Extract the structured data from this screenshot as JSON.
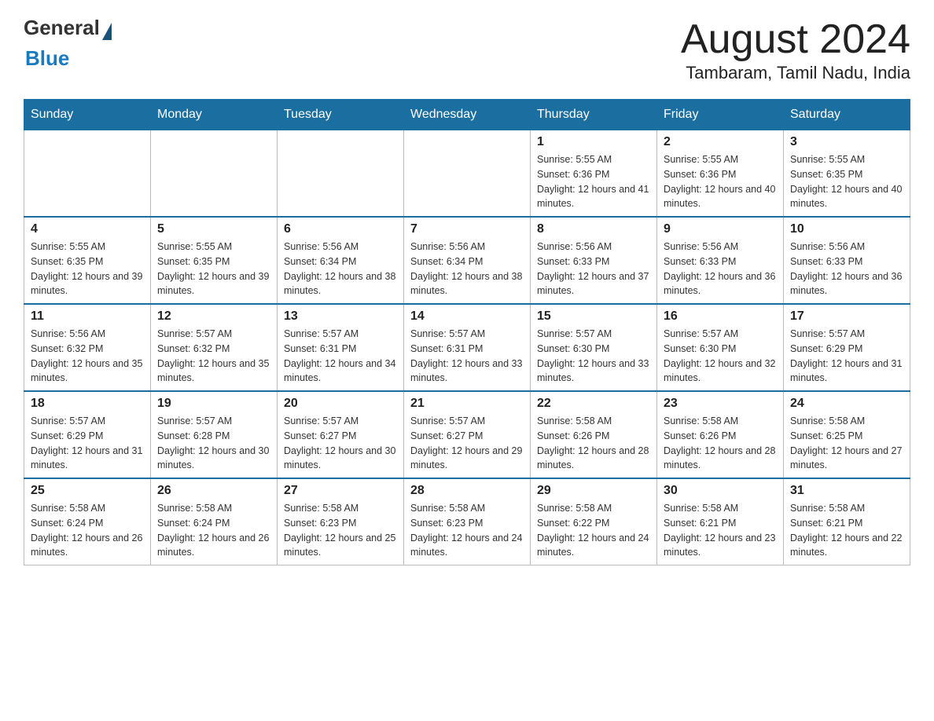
{
  "header": {
    "logo_general": "General",
    "logo_blue": "Blue",
    "month_title": "August 2024",
    "location": "Tambaram, Tamil Nadu, India"
  },
  "weekdays": [
    "Sunday",
    "Monday",
    "Tuesday",
    "Wednesday",
    "Thursday",
    "Friday",
    "Saturday"
  ],
  "weeks": [
    [
      {
        "day": "",
        "sunrise": "",
        "sunset": "",
        "daylight": ""
      },
      {
        "day": "",
        "sunrise": "",
        "sunset": "",
        "daylight": ""
      },
      {
        "day": "",
        "sunrise": "",
        "sunset": "",
        "daylight": ""
      },
      {
        "day": "",
        "sunrise": "",
        "sunset": "",
        "daylight": ""
      },
      {
        "day": "1",
        "sunrise": "Sunrise: 5:55 AM",
        "sunset": "Sunset: 6:36 PM",
        "daylight": "Daylight: 12 hours and 41 minutes."
      },
      {
        "day": "2",
        "sunrise": "Sunrise: 5:55 AM",
        "sunset": "Sunset: 6:36 PM",
        "daylight": "Daylight: 12 hours and 40 minutes."
      },
      {
        "day": "3",
        "sunrise": "Sunrise: 5:55 AM",
        "sunset": "Sunset: 6:35 PM",
        "daylight": "Daylight: 12 hours and 40 minutes."
      }
    ],
    [
      {
        "day": "4",
        "sunrise": "Sunrise: 5:55 AM",
        "sunset": "Sunset: 6:35 PM",
        "daylight": "Daylight: 12 hours and 39 minutes."
      },
      {
        "day": "5",
        "sunrise": "Sunrise: 5:55 AM",
        "sunset": "Sunset: 6:35 PM",
        "daylight": "Daylight: 12 hours and 39 minutes."
      },
      {
        "day": "6",
        "sunrise": "Sunrise: 5:56 AM",
        "sunset": "Sunset: 6:34 PM",
        "daylight": "Daylight: 12 hours and 38 minutes."
      },
      {
        "day": "7",
        "sunrise": "Sunrise: 5:56 AM",
        "sunset": "Sunset: 6:34 PM",
        "daylight": "Daylight: 12 hours and 38 minutes."
      },
      {
        "day": "8",
        "sunrise": "Sunrise: 5:56 AM",
        "sunset": "Sunset: 6:33 PM",
        "daylight": "Daylight: 12 hours and 37 minutes."
      },
      {
        "day": "9",
        "sunrise": "Sunrise: 5:56 AM",
        "sunset": "Sunset: 6:33 PM",
        "daylight": "Daylight: 12 hours and 36 minutes."
      },
      {
        "day": "10",
        "sunrise": "Sunrise: 5:56 AM",
        "sunset": "Sunset: 6:33 PM",
        "daylight": "Daylight: 12 hours and 36 minutes."
      }
    ],
    [
      {
        "day": "11",
        "sunrise": "Sunrise: 5:56 AM",
        "sunset": "Sunset: 6:32 PM",
        "daylight": "Daylight: 12 hours and 35 minutes."
      },
      {
        "day": "12",
        "sunrise": "Sunrise: 5:57 AM",
        "sunset": "Sunset: 6:32 PM",
        "daylight": "Daylight: 12 hours and 35 minutes."
      },
      {
        "day": "13",
        "sunrise": "Sunrise: 5:57 AM",
        "sunset": "Sunset: 6:31 PM",
        "daylight": "Daylight: 12 hours and 34 minutes."
      },
      {
        "day": "14",
        "sunrise": "Sunrise: 5:57 AM",
        "sunset": "Sunset: 6:31 PM",
        "daylight": "Daylight: 12 hours and 33 minutes."
      },
      {
        "day": "15",
        "sunrise": "Sunrise: 5:57 AM",
        "sunset": "Sunset: 6:30 PM",
        "daylight": "Daylight: 12 hours and 33 minutes."
      },
      {
        "day": "16",
        "sunrise": "Sunrise: 5:57 AM",
        "sunset": "Sunset: 6:30 PM",
        "daylight": "Daylight: 12 hours and 32 minutes."
      },
      {
        "day": "17",
        "sunrise": "Sunrise: 5:57 AM",
        "sunset": "Sunset: 6:29 PM",
        "daylight": "Daylight: 12 hours and 31 minutes."
      }
    ],
    [
      {
        "day": "18",
        "sunrise": "Sunrise: 5:57 AM",
        "sunset": "Sunset: 6:29 PM",
        "daylight": "Daylight: 12 hours and 31 minutes."
      },
      {
        "day": "19",
        "sunrise": "Sunrise: 5:57 AM",
        "sunset": "Sunset: 6:28 PM",
        "daylight": "Daylight: 12 hours and 30 minutes."
      },
      {
        "day": "20",
        "sunrise": "Sunrise: 5:57 AM",
        "sunset": "Sunset: 6:27 PM",
        "daylight": "Daylight: 12 hours and 30 minutes."
      },
      {
        "day": "21",
        "sunrise": "Sunrise: 5:57 AM",
        "sunset": "Sunset: 6:27 PM",
        "daylight": "Daylight: 12 hours and 29 minutes."
      },
      {
        "day": "22",
        "sunrise": "Sunrise: 5:58 AM",
        "sunset": "Sunset: 6:26 PM",
        "daylight": "Daylight: 12 hours and 28 minutes."
      },
      {
        "day": "23",
        "sunrise": "Sunrise: 5:58 AM",
        "sunset": "Sunset: 6:26 PM",
        "daylight": "Daylight: 12 hours and 28 minutes."
      },
      {
        "day": "24",
        "sunrise": "Sunrise: 5:58 AM",
        "sunset": "Sunset: 6:25 PM",
        "daylight": "Daylight: 12 hours and 27 minutes."
      }
    ],
    [
      {
        "day": "25",
        "sunrise": "Sunrise: 5:58 AM",
        "sunset": "Sunset: 6:24 PM",
        "daylight": "Daylight: 12 hours and 26 minutes."
      },
      {
        "day": "26",
        "sunrise": "Sunrise: 5:58 AM",
        "sunset": "Sunset: 6:24 PM",
        "daylight": "Daylight: 12 hours and 26 minutes."
      },
      {
        "day": "27",
        "sunrise": "Sunrise: 5:58 AM",
        "sunset": "Sunset: 6:23 PM",
        "daylight": "Daylight: 12 hours and 25 minutes."
      },
      {
        "day": "28",
        "sunrise": "Sunrise: 5:58 AM",
        "sunset": "Sunset: 6:23 PM",
        "daylight": "Daylight: 12 hours and 24 minutes."
      },
      {
        "day": "29",
        "sunrise": "Sunrise: 5:58 AM",
        "sunset": "Sunset: 6:22 PM",
        "daylight": "Daylight: 12 hours and 24 minutes."
      },
      {
        "day": "30",
        "sunrise": "Sunrise: 5:58 AM",
        "sunset": "Sunset: 6:21 PM",
        "daylight": "Daylight: 12 hours and 23 minutes."
      },
      {
        "day": "31",
        "sunrise": "Sunrise: 5:58 AM",
        "sunset": "Sunset: 6:21 PM",
        "daylight": "Daylight: 12 hours and 22 minutes."
      }
    ]
  ]
}
